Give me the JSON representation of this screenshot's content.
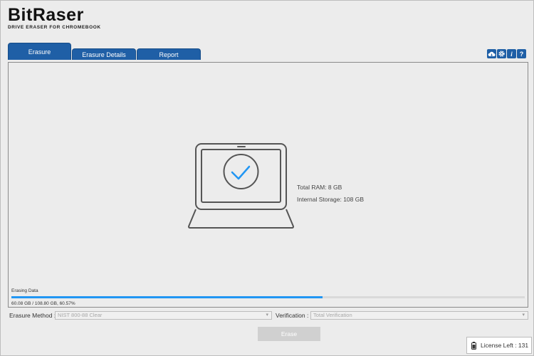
{
  "header": {
    "logo_title": "BitRaser",
    "logo_subtitle": "DRIVE ERASER FOR CHROMEBOOK"
  },
  "tabs": [
    {
      "label": "Erasure",
      "active": true
    },
    {
      "label": "Erasure Details",
      "active": false
    },
    {
      "label": "Report",
      "active": false
    }
  ],
  "toolbar": {
    "icons": [
      "cloud-icon",
      "gear-icon",
      "info-icon",
      "help-icon"
    ],
    "info_glyph": "i",
    "help_glyph": "?"
  },
  "device": {
    "total_ram": "Total RAM: 8 GB",
    "internal_storage": "Internal Storage: 108 GB"
  },
  "progress": {
    "label": "Erasing Data",
    "text": "60.08 GB / 108.80 GB, 60.57%",
    "fraction": 0.6057
  },
  "controls": {
    "method_label": "Erasure Method :",
    "method_value": "NIST 800-88 Clear",
    "verification_label": "Verification :",
    "verification_value": "Total Verification",
    "erase_label": "Erase"
  },
  "license": {
    "text": "License Left :  131"
  },
  "colors": {
    "accent": "#1f5fa6",
    "progress": "#2196f3",
    "check": "#2196f3"
  }
}
